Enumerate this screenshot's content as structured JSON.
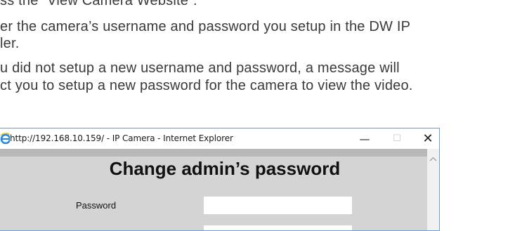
{
  "instructions": {
    "line1": "ss the “View Camera Website”.",
    "line2": "er the camera’s username and password you setup in the DW IP",
    "line3": "ler.",
    "line4": "u did not setup a new username and password, a message will",
    "line5": "ct you to setup a new password for the camera to view the video."
  },
  "browser": {
    "title": "http://192.168.10.159/ - IP Camera - Internet Explorer",
    "app_icon": "internet-explorer-icon",
    "minimize_glyph": "—",
    "maximize_glyph": "☐",
    "close_glyph": "✕"
  },
  "page": {
    "heading": "Change admin’s password",
    "password_label": "Password",
    "password_value": "",
    "confirm_value": ""
  },
  "colors": {
    "content_bg": "#d4d4d4",
    "content_top_bar": "#b8b8b8",
    "window_border": "#6b9fd6",
    "doc_text": "#3a3a3a"
  }
}
